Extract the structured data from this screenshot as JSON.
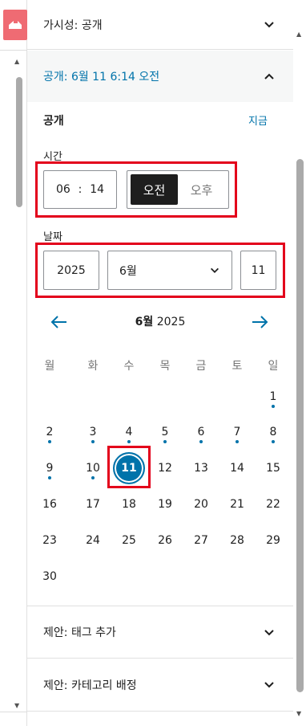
{
  "sidebar": {
    "logo_icon": "plugin-logo-icon",
    "accent": "#ef6b73"
  },
  "visibility": {
    "label": "가시성:",
    "value": "공개"
  },
  "publish": {
    "header_label": "공개:",
    "header_value": "6월 11 6:14 오전",
    "section_title": "공개",
    "now_link": "지금",
    "time_label": "시간",
    "hour": "06",
    "colon": ":",
    "minute": "14",
    "am": "오전",
    "pm": "오후",
    "date_label": "날짜",
    "year": "2025",
    "month": "6월",
    "day": "11"
  },
  "calendar": {
    "month_label": "6월",
    "year_label": "2025",
    "weekdays": [
      "월",
      "화",
      "수",
      "목",
      "금",
      "토",
      "일"
    ],
    "selected_day": 11,
    "days_with_posts": [
      1,
      2,
      3,
      4,
      5,
      6,
      7,
      8,
      9,
      10
    ],
    "accent": "#0073aa"
  },
  "tags": {
    "label": "제안:",
    "value": "태그 추가"
  },
  "categories": {
    "label": "제안:",
    "value": "카테고리 배정"
  }
}
